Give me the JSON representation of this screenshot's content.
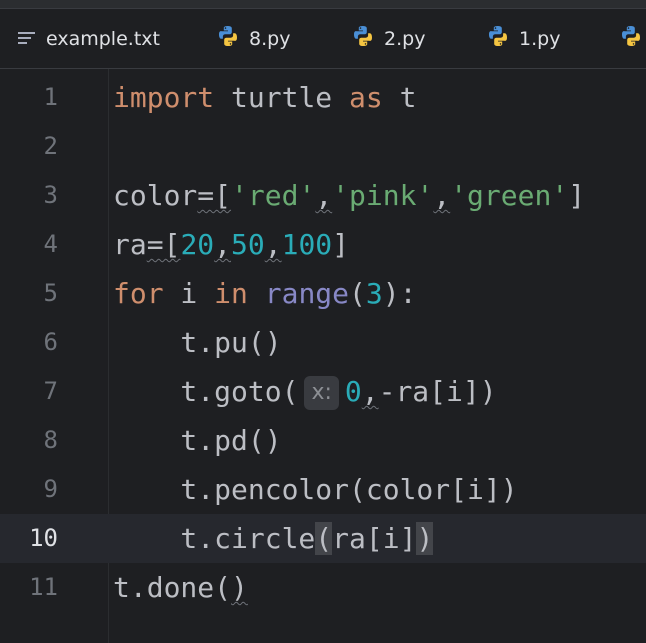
{
  "tabs": [
    {
      "label": "example.txt",
      "icon": "text-file-icon"
    },
    {
      "label": "8.py",
      "icon": "python-file-icon"
    },
    {
      "label": "2.py",
      "icon": "python-file-icon"
    },
    {
      "label": "1.py",
      "icon": "python-file-icon"
    },
    {
      "label": "",
      "icon": "python-file-icon"
    }
  ],
  "editor": {
    "current_line": 10,
    "line_numbers": [
      "1",
      "2",
      "3",
      "4",
      "5",
      "6",
      "7",
      "8",
      "9",
      "10",
      "11"
    ],
    "code": {
      "l1": {
        "kw_import": "import",
        "mod": " turtle ",
        "kw_as": "as",
        "alias": " t"
      },
      "l3": {
        "name": "color",
        "eq": "=[",
        "s1": "'red'",
        "c1": ",",
        "s2": "'pink'",
        "c2": ",",
        "s3": "'green'",
        "end": "]"
      },
      "l4": {
        "name": "ra",
        "eq": "=[",
        "n1": "20",
        "c1": ",",
        "n2": "50",
        "c2": ",",
        "n3": "100",
        "end": "]"
      },
      "l5": {
        "kw_for": "for",
        "var": " i ",
        "kw_in": "in",
        "sp": " ",
        "fn": "range",
        "open": "(",
        "num": "3",
        "close": "):"
      },
      "l6": {
        "text": "    t.pu()"
      },
      "l7": {
        "pre": "    t.goto(",
        "hint": "x:",
        "num": "0",
        "comma": ",",
        "rest": "-ra[i])"
      },
      "l8": {
        "text": "    t.pd()"
      },
      "l9": {
        "text": "    t.pencolor(color[i])"
      },
      "l10": {
        "pre": "    t.circle",
        "open": "(",
        "mid": "ra[i]",
        "close": ")"
      },
      "l11": {
        "pre": "t.done(",
        "close": ")"
      }
    }
  },
  "colors": {
    "background": "#1e1f22",
    "keyword": "#cf8e6d",
    "string": "#6aab73",
    "number": "#2aacb8",
    "builtin": "#8888c6",
    "text": "#bcbec4"
  }
}
